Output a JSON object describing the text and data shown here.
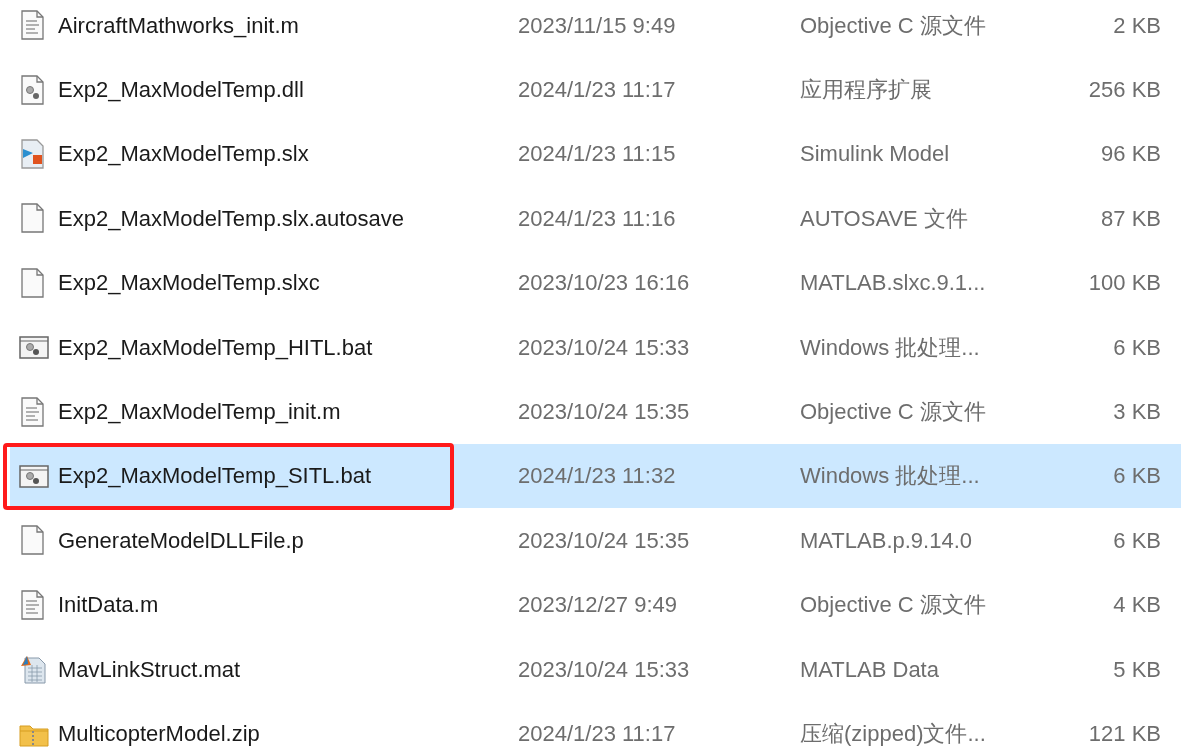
{
  "files": [
    {
      "name": "AircraftMathworks_init.m",
      "date": "2023/11/15 9:49",
      "type": "Objective C 源文件",
      "size": "2 KB",
      "kind": "text",
      "selected": false,
      "outlined": false
    },
    {
      "name": "Exp2_MaxModelTemp.dll",
      "date": "2024/1/23 11:17",
      "type": "应用程序扩展",
      "size": "256 KB",
      "kind": "gears",
      "selected": false,
      "outlined": false
    },
    {
      "name": "Exp2_MaxModelTemp.slx",
      "date": "2024/1/23 11:15",
      "type": "Simulink Model",
      "size": "96 KB",
      "kind": "model",
      "selected": false,
      "outlined": false
    },
    {
      "name": "Exp2_MaxModelTemp.slx.autosave",
      "date": "2024/1/23 11:16",
      "type": "AUTOSAVE 文件",
      "size": "87 KB",
      "kind": "blank",
      "selected": false,
      "outlined": false
    },
    {
      "name": "Exp2_MaxModelTemp.slxc",
      "date": "2023/10/23 16:16",
      "type": "MATLAB.slxc.9.1...",
      "size": "100 KB",
      "kind": "blank",
      "selected": false,
      "outlined": false
    },
    {
      "name": "Exp2_MaxModelTemp_HITL.bat",
      "date": "2023/10/24 15:33",
      "type": "Windows 批处理...",
      "size": "6 KB",
      "kind": "batch",
      "selected": false,
      "outlined": false
    },
    {
      "name": "Exp2_MaxModelTemp_init.m",
      "date": "2023/10/24 15:35",
      "type": "Objective C 源文件",
      "size": "3 KB",
      "kind": "text",
      "selected": false,
      "outlined": false
    },
    {
      "name": "Exp2_MaxModelTemp_SITL.bat",
      "date": "2024/1/23 11:32",
      "type": "Windows 批处理...",
      "size": "6 KB",
      "kind": "batch",
      "selected": true,
      "outlined": true
    },
    {
      "name": "GenerateModelDLLFile.p",
      "date": "2023/10/24 15:35",
      "type": "MATLAB.p.9.14.0",
      "size": "6 KB",
      "kind": "blank",
      "selected": false,
      "outlined": false
    },
    {
      "name": "InitData.m",
      "date": "2023/12/27 9:49",
      "type": "Objective C 源文件",
      "size": "4 KB",
      "kind": "text",
      "selected": false,
      "outlined": false
    },
    {
      "name": "MavLinkStruct.mat",
      "date": "2023/10/24 15:33",
      "type": "MATLAB Data",
      "size": "5 KB",
      "kind": "data",
      "selected": false,
      "outlined": false
    },
    {
      "name": "MulticopterModel.zip",
      "date": "2024/1/23 11:17",
      "type": "压缩(zipped)文件...",
      "size": "121 KB",
      "kind": "zip",
      "selected": false,
      "outlined": false
    }
  ]
}
